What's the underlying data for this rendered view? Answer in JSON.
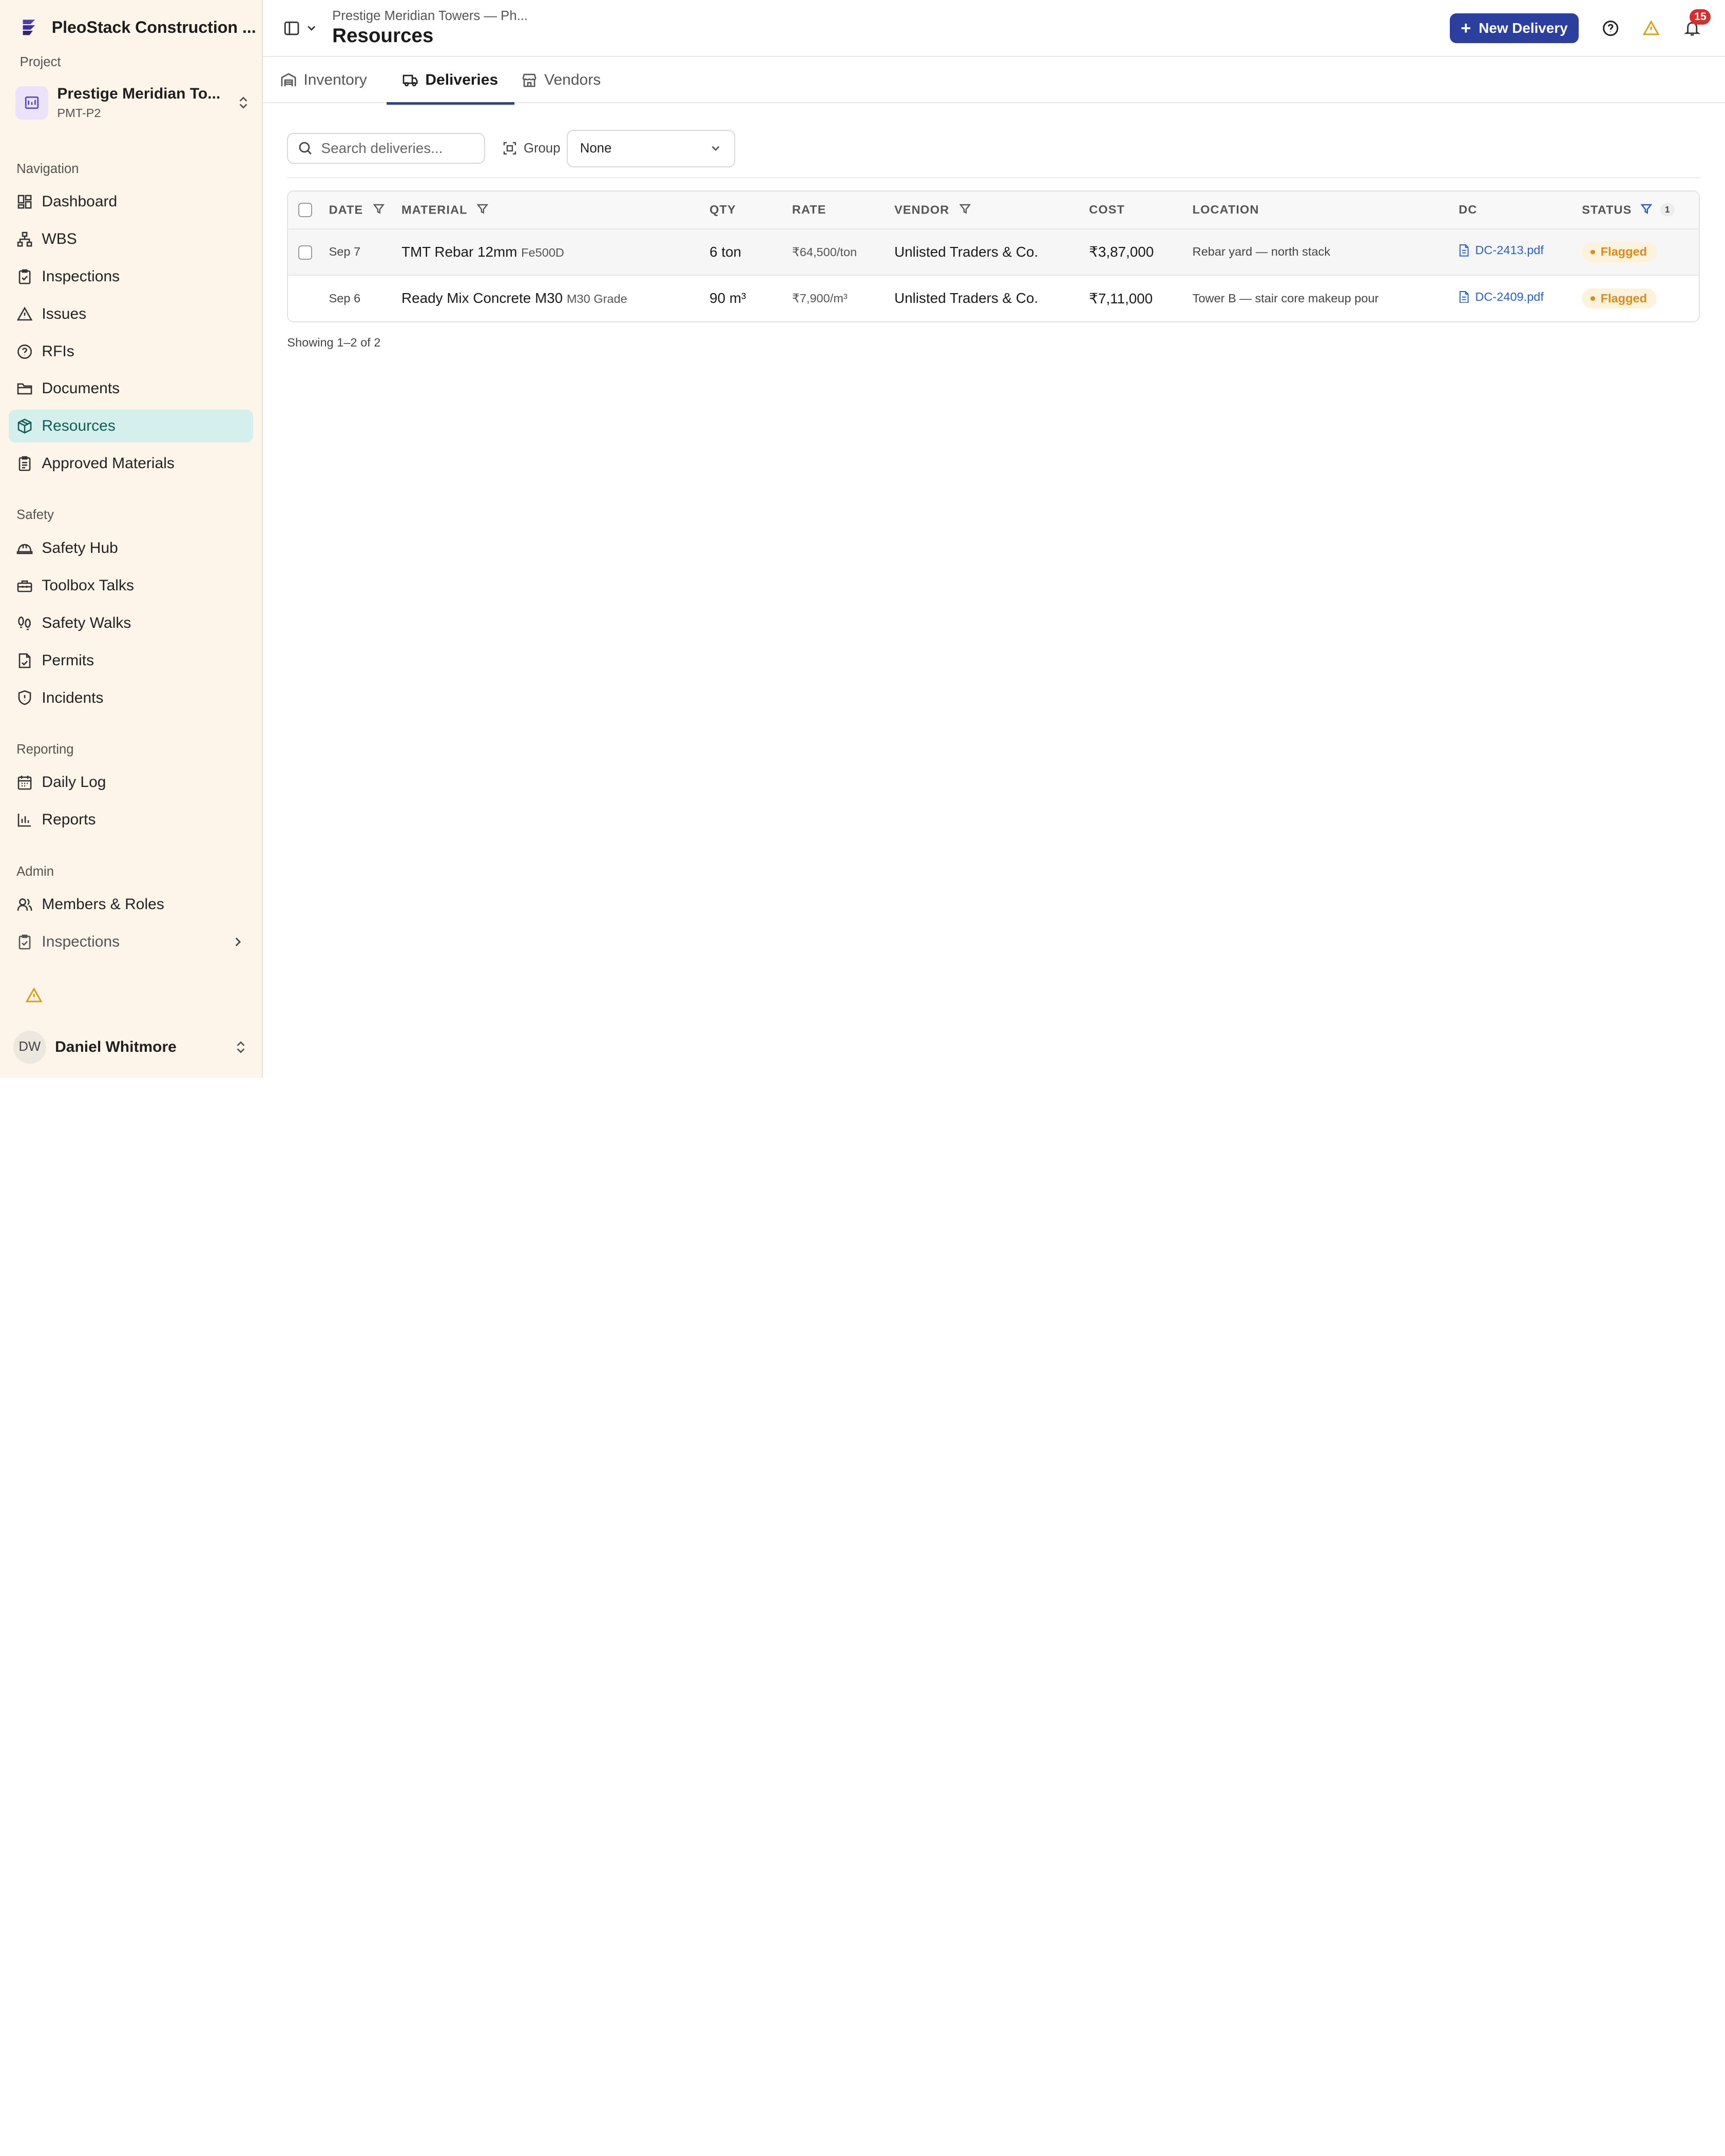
{
  "brand": {
    "name": "PleoStack Construction ..."
  },
  "project": {
    "section_label": "Project",
    "name": "Prestige Meridian To...",
    "code": "PMT-P2"
  },
  "nav": {
    "navigation_label": "Navigation",
    "navigation": [
      {
        "label": "Dashboard",
        "icon": "dashboard-icon"
      },
      {
        "label": "WBS",
        "icon": "hierarchy-icon"
      },
      {
        "label": "Inspections",
        "icon": "clipboard-check-icon"
      },
      {
        "label": "Issues",
        "icon": "warning-icon"
      },
      {
        "label": "RFIs",
        "icon": "question-circle-icon"
      },
      {
        "label": "Documents",
        "icon": "folder-icon"
      },
      {
        "label": "Resources",
        "icon": "box-icon"
      },
      {
        "label": "Approved Materials",
        "icon": "clipboard-icon"
      }
    ],
    "safety_label": "Safety",
    "safety": [
      {
        "label": "Safety Hub",
        "icon": "hard-hat-icon"
      },
      {
        "label": "Toolbox Talks",
        "icon": "toolbox-icon"
      },
      {
        "label": "Safety Walks",
        "icon": "footprints-icon"
      },
      {
        "label": "Permits",
        "icon": "file-check-icon"
      },
      {
        "label": "Incidents",
        "icon": "shield-alert-icon"
      }
    ],
    "reporting_label": "Reporting",
    "reporting": [
      {
        "label": "Daily Log",
        "icon": "calendar-icon"
      },
      {
        "label": "Reports",
        "icon": "bar-chart-icon"
      }
    ],
    "admin_label": "Admin",
    "admin": [
      {
        "label": "Members & Roles",
        "icon": "users-icon"
      },
      {
        "label": "Inspections",
        "icon": "clipboard-check-icon"
      }
    ]
  },
  "user": {
    "initials": "DW",
    "name": "Daniel Whitmore"
  },
  "header": {
    "breadcrumb": "Prestige Meridian Towers — Ph...",
    "title": "Resources",
    "new_button": "New Delivery",
    "notification_count": "15"
  },
  "tabs": [
    "Inventory",
    "Deliveries",
    "Vendors"
  ],
  "toolbar": {
    "search_placeholder": "Search deliveries...",
    "group_label": "Group",
    "group_value": "None"
  },
  "table": {
    "columns": {
      "date": "DATE",
      "material": "MATERIAL",
      "qty": "QTY",
      "rate": "RATE",
      "vendor": "VENDOR",
      "cost": "COST",
      "location": "LOCATION",
      "dc": "DC",
      "status": "STATUS"
    },
    "status_filter_count": "1",
    "rows": [
      {
        "date": "Sep 7",
        "material": "TMT Rebar 12mm",
        "grade": "Fe500D",
        "qty": "6 ton",
        "rate": "₹64,500/ton",
        "vendor": "Unlisted Traders & Co.",
        "cost": "₹3,87,000",
        "location": "Rebar yard — north stack",
        "dc": "DC-2413.pdf",
        "status": "Flagged"
      },
      {
        "date": "Sep 6",
        "material": "Ready Mix Concrete M30",
        "grade": "M30 Grade",
        "qty": "90 m³",
        "rate": "₹7,900/m³",
        "vendor": "Unlisted Traders & Co.",
        "cost": "₹7,11,000",
        "location": "Tower B — stair core makeup pour",
        "dc": "DC-2409.pdf",
        "status": "Flagged"
      }
    ],
    "footer": "Showing 1–2 of 2"
  },
  "colors": {
    "accent": "#2b3f9e",
    "sidebar_bg": "#fdf4ea",
    "active_nav_bg": "#d4efec",
    "flagged": "#e08a17",
    "flagged_bg": "#fdf2dc",
    "link": "#2560d6",
    "badge": "#d92d2d"
  }
}
